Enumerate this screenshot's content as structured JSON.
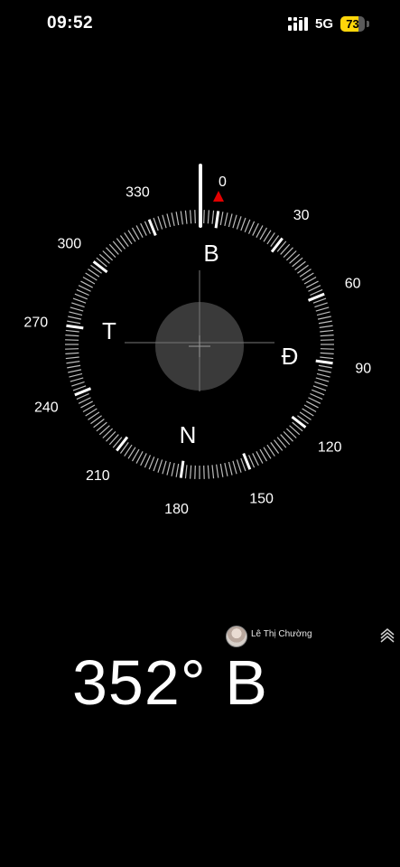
{
  "status_bar": {
    "time": "09:52",
    "network": "5G",
    "battery_percent": 73,
    "battery_label": "73",
    "battery_color": "#ffd60a"
  },
  "compass": {
    "degree_labels": [
      "0",
      "30",
      "60",
      "90",
      "120",
      "150",
      "180",
      "210",
      "240",
      "270",
      "300",
      "330"
    ],
    "cardinals": {
      "north": "B",
      "east": "Đ",
      "south": "N",
      "west": "T"
    },
    "heading_deg": 352,
    "target_marker_color": "#e30000"
  },
  "user": {
    "name": "Lê Thị Chường"
  },
  "reading": {
    "heading_text": "352° B"
  },
  "icons": [
    "signal-icon",
    "battery-icon",
    "avatar",
    "layers-icon"
  ]
}
